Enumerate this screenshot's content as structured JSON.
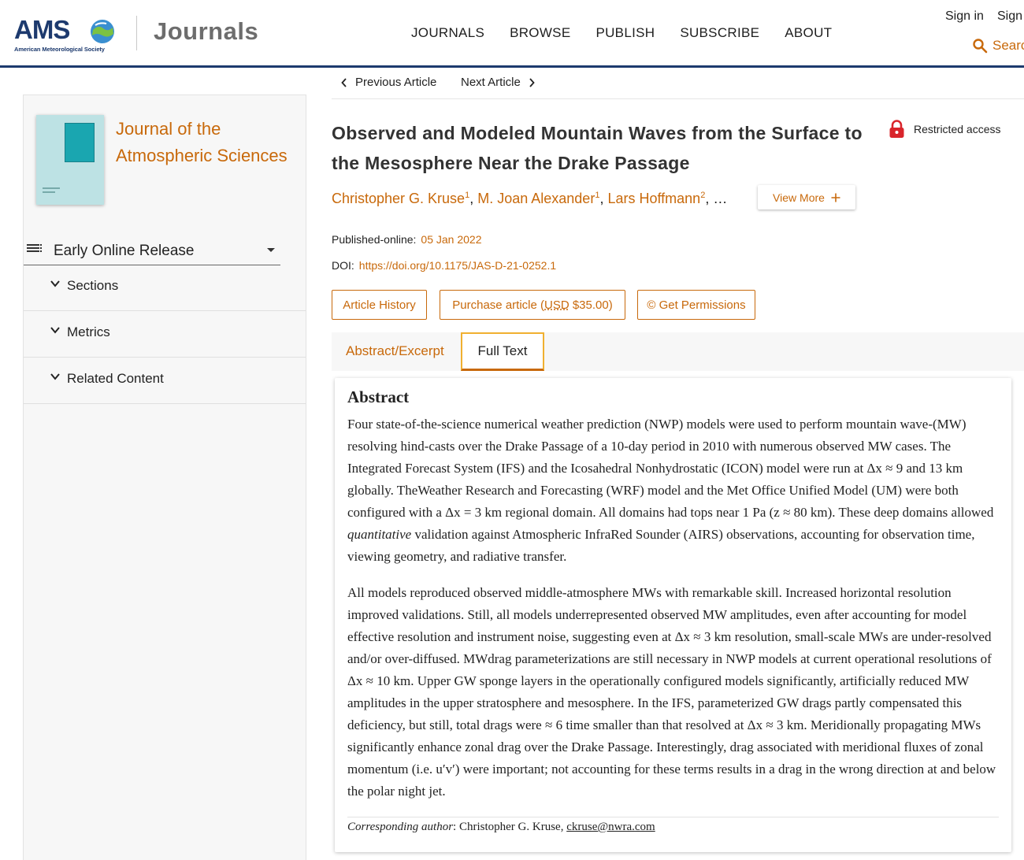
{
  "header": {
    "logo_text": "AMS",
    "logo_subtitle": "American Meteorological Society",
    "brand": "Journals",
    "nav": [
      "JOURNALS",
      "BROWSE",
      "PUBLISH",
      "SUBSCRIBE",
      "ABOUT"
    ],
    "sign_in": "Sign in",
    "sign_up": "Sign",
    "search": "Searc"
  },
  "sidebar": {
    "journal_name": "Journal of the Atmospheric Sciences",
    "issue_select": "Early Online Release",
    "sections": [
      "Sections",
      "Metrics",
      "Related Content"
    ]
  },
  "article_nav": {
    "previous": "Previous Article",
    "next": "Next Article"
  },
  "article": {
    "title": "Observed and Modeled Mountain Waves from the Surface to the Mesosphere Near the Drake Passage",
    "access": "Restricted access",
    "authors": [
      {
        "name": "Christopher G. Kruse",
        "aff": "1"
      },
      {
        "name": "M. Joan Alexander",
        "aff": "1"
      },
      {
        "name": "Lars Hoffmann",
        "aff": "2"
      }
    ],
    "authors_ellipsis": "…",
    "view_more": "View More",
    "published_label": "Published-online:",
    "published_date": "05 Jan 2022",
    "doi_label": "DOI:",
    "doi": "https://doi.org/10.1175/JAS-D-21-0252.1",
    "buttons": {
      "history": "Article History",
      "purchase_prefix": "Purchase article (",
      "purchase_currency": "USD",
      "purchase_suffix": " $35.00)",
      "permissions": "© Get Permissions"
    },
    "tabs": {
      "abstract": "Abstract/Excerpt",
      "full_text": "Full Text"
    }
  },
  "abstract": {
    "heading": "Abstract",
    "para1_a": "Four state-of-the-science numerical weather prediction (NWP) models were used to perform mountain wave-(MW) resolving hind-casts over the Drake Passage of a 10-day period in 2010 with numerous observed MW cases. The Integrated Forecast System (IFS) and the Icosahedral Nonhydrostatic (ICON) model were run at Δx ≈ 9 and 13 km globally. TheWeather Research and Forecasting (WRF) model and the Met Office Unified Model (UM) were both configured with a Δx = 3 km regional domain. All domains had tops near 1 Pa (z ≈ 80 km). These deep domains allowed ",
    "para1_em": "quantitative",
    "para1_b": " validation against Atmospheric InfraRed Sounder (AIRS) observations, accounting for observation time, viewing geometry, and radiative transfer.",
    "para2": "All models reproduced observed middle-atmosphere MWs with remarkable skill. Increased horizontal resolution improved validations. Still, all models underrepresented observed MW amplitudes, even after accounting for model effective resolution and instrument noise, suggesting even at Δx ≈ 3 km resolution, small-scale MWs are under-resolved and/or over-diffused. MWdrag parameterizations are still necessary in NWP models at current operational resolutions of Δx ≈ 10 km. Upper GW sponge layers in the operationally configured models significantly, artificially reduced MW amplitudes in the upper stratosphere and mesosphere. In the IFS, parameterized GW drags partly compensated this deficiency, but still, total drags were ≈ 6 time smaller than that resolved at Δx ≈ 3 km. Meridionally propagating MWs significantly enhance zonal drag over the Drake Passage. Interestingly, drag associated with meridional fluxes of zonal momentum (i.e. u′v′) were important; not accounting for these terms results in a drag in the wrong direction at and below the polar night jet.",
    "corresponding_label": "Corresponding author",
    "corresponding_name": ": Christopher G. Kruse, ",
    "corresponding_email": "ckruse@nwra.com"
  },
  "colors": {
    "accent": "#c8690b",
    "navy": "#1d3a6e",
    "tab_highlight": "#f0b030"
  }
}
